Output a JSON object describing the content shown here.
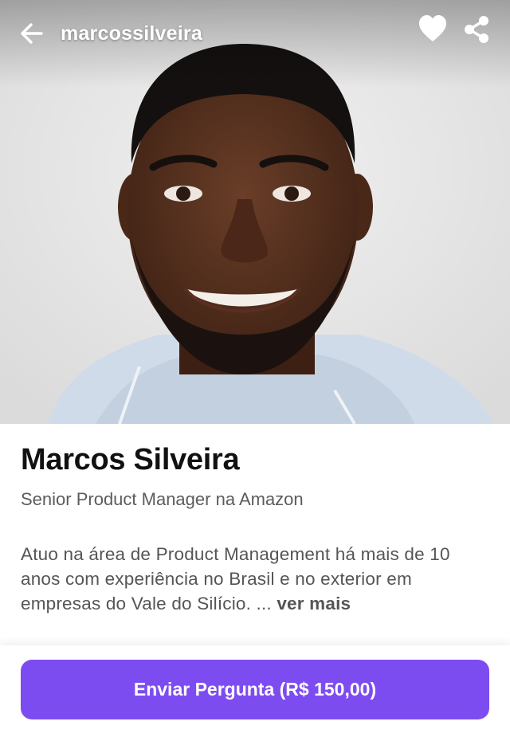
{
  "header": {
    "username": "marcossilveira",
    "back_icon": "arrow-left-icon",
    "like_icon": "heart-icon",
    "share_icon": "share-icon"
  },
  "profile": {
    "name": "Marcos Silveira",
    "role": "Senior Product Manager na Amazon",
    "bio": "Atuo na área de Product Management há mais de 10 anos com experiência no Brasil e no exterior em empresas do Vale do Silício. ... ",
    "more_label": "ver mais"
  },
  "action": {
    "button_label": "Enviar Pergunta (R$ 150,00)"
  },
  "colors": {
    "accent": "#7d4cf1",
    "photo_background": "#e9e8e8",
    "hoodie": "#cfdbe9"
  }
}
